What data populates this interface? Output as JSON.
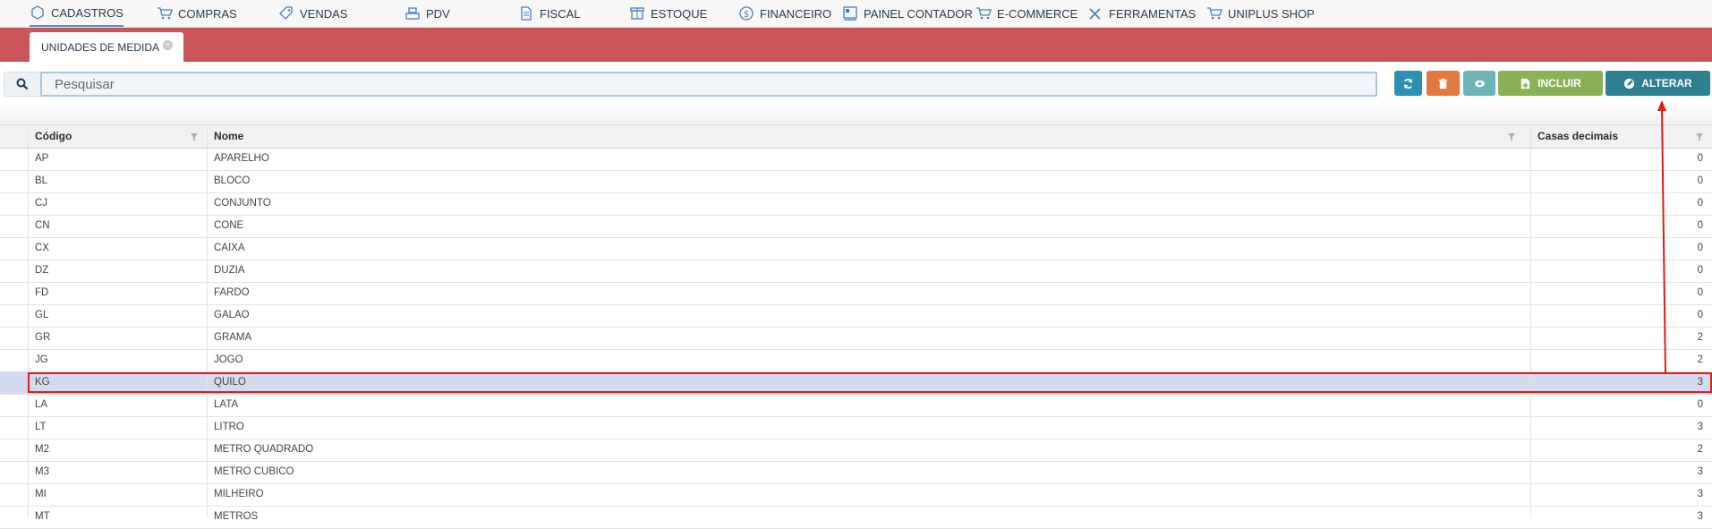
{
  "menu": [
    {
      "label": "CADASTROS",
      "icon": "hexagon-icon"
    },
    {
      "label": "COMPRAS",
      "icon": "cart-icon"
    },
    {
      "label": "VENDAS",
      "icon": "tag-icon"
    },
    {
      "label": "PDV",
      "icon": "register-icon"
    },
    {
      "label": "FISCAL",
      "icon": "document-icon"
    },
    {
      "label": "ESTOQUE",
      "icon": "box-icon"
    },
    {
      "label": "FINANCEIRO",
      "icon": "dollar-icon"
    },
    {
      "label": "PAINEL CONTADOR",
      "icon": "panel-icon"
    },
    {
      "label": "E-COMMERCE",
      "icon": "cart-icon"
    },
    {
      "label": "FERRAMENTAS",
      "icon": "tools-icon"
    },
    {
      "label": "UNIPLUS SHOP",
      "icon": "cart-icon"
    }
  ],
  "tab": {
    "label": "UNIDADES DE MEDIDA"
  },
  "search": {
    "placeholder": "Pesquisar",
    "value": ""
  },
  "toolbar": {
    "incluir_label": "INCLUIR",
    "alterar_label": "ALTERAR",
    "colors": {
      "refresh": "#2e8fb4",
      "delete": "#e27a3f",
      "view": "#6fb4b4",
      "incluir": "#8ab155",
      "alterar": "#2e7f8f"
    }
  },
  "table": {
    "columns": [
      "Código",
      "Nome",
      "Casas decimais"
    ],
    "rows": [
      {
        "codigo": "AP",
        "nome": "APARELHO",
        "casas": "0"
      },
      {
        "codigo": "BL",
        "nome": "BLOCO",
        "casas": "0"
      },
      {
        "codigo": "CJ",
        "nome": "CONJUNTO",
        "casas": "0"
      },
      {
        "codigo": "CN",
        "nome": "CONE",
        "casas": "0"
      },
      {
        "codigo": "CX",
        "nome": "CAIXA",
        "casas": "0"
      },
      {
        "codigo": "DZ",
        "nome": "DUZIA",
        "casas": "0"
      },
      {
        "codigo": "FD",
        "nome": "FARDO",
        "casas": "0"
      },
      {
        "codigo": "GL",
        "nome": "GALAO",
        "casas": "0"
      },
      {
        "codigo": "GR",
        "nome": "GRAMA",
        "casas": "2"
      },
      {
        "codigo": "JG",
        "nome": "JOGO",
        "casas": "2"
      },
      {
        "codigo": "KG",
        "nome": "QUILO",
        "casas": "3",
        "selected": true
      },
      {
        "codigo": "LA",
        "nome": "LATA",
        "casas": "0"
      },
      {
        "codigo": "LT",
        "nome": "LITRO",
        "casas": "3"
      },
      {
        "codigo": "M2",
        "nome": "METRO QUADRADO",
        "casas": "2"
      },
      {
        "codigo": "M3",
        "nome": "METRO CUBICO",
        "casas": "3"
      },
      {
        "codigo": "MI",
        "nome": "MILHEIRO",
        "casas": "3"
      },
      {
        "codigo": "MT",
        "nome": "METROS",
        "casas": "3"
      }
    ]
  },
  "colors": {
    "band": "#c9555a",
    "selected_row": "#d5dbee",
    "highlight": "#e01b1b"
  }
}
